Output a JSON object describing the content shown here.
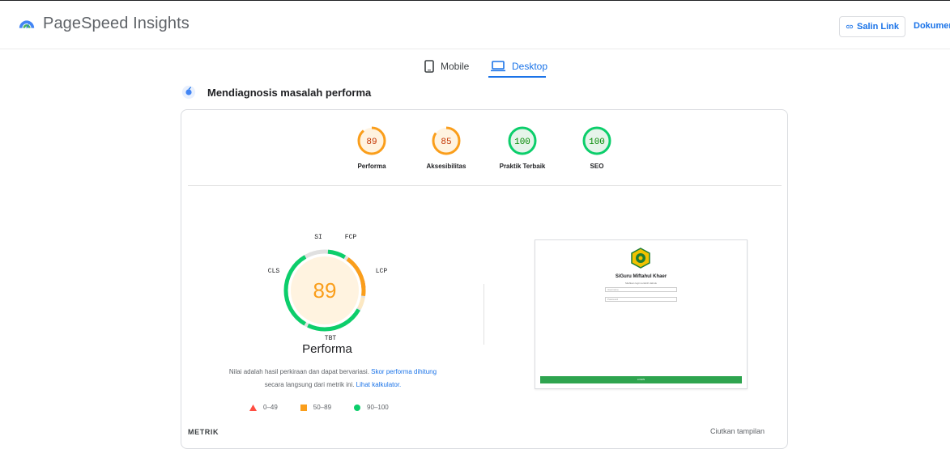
{
  "header": {
    "app_name": "PageSpeed Insights",
    "copy_link_label": "Salin Link",
    "docs_label": "Dokumentasi"
  },
  "tabs": [
    {
      "label": "Mobile",
      "icon": "smartphone-icon",
      "active": false
    },
    {
      "label": "Desktop",
      "icon": "laptop-icon",
      "active": true
    }
  ],
  "diagnosis": {
    "title": "Mendiagnosis masalah performa",
    "icon": "lighthouse-icon"
  },
  "scores": [
    {
      "value": "89",
      "label": "Performa",
      "color": "#fa9e1b",
      "fill": "#fff3e0",
      "text_color": "#c33300",
      "fraction": 0.89
    },
    {
      "value": "85",
      "label": "Aksesibilitas",
      "color": "#fa9e1b",
      "fill": "#fff3e0",
      "text_color": "#c33300",
      "fraction": 0.85
    },
    {
      "value": "100",
      "label": "Praktik Terbaik",
      "color": "#0cce6b",
      "fill": "#e6f4ea",
      "text_color": "#008800",
      "fraction": 1.0
    },
    {
      "value": "100",
      "label": "SEO",
      "color": "#0cce6b",
      "fill": "#e6f4ea",
      "text_color": "#008800",
      "fraction": 1.0
    }
  ],
  "performance": {
    "score": "89",
    "title": "Performa",
    "color": "#fa9e1b",
    "segments": [
      {
        "metric": "SI",
        "color": "#ff4e42"
      },
      {
        "metric": "FCP",
        "color": "#0cce6b"
      },
      {
        "metric": "LCP",
        "color": "#fa9e1b"
      },
      {
        "metric": "TBT",
        "color": "#0cce6b"
      },
      {
        "metric": "CLS",
        "color": "#0cce6b"
      }
    ],
    "note_text": "Nilai adalah hasil perkiraan dan dapat bervariasi. ",
    "note_link1": "Skor performa dihitung",
    "note_text2": "secara langsung dari metrik ini. ",
    "note_link2": "Lihat kalkulator."
  },
  "legend": [
    {
      "range": "0–49",
      "shape": "triangle",
      "color": "#ff4e42"
    },
    {
      "range": "50–89",
      "shape": "square",
      "color": "#fa9e1b"
    },
    {
      "range": "90–100",
      "shape": "circle",
      "color": "#0cce6b"
    }
  ],
  "preview": {
    "site_title": "SiGuru Miftahul Khaer",
    "site_subtitle": "Silahkan login terlebih dahulu",
    "username_placeholder": "Username",
    "password_placeholder": "Password",
    "login_label": "LOGIN"
  },
  "metrics": {
    "label": "METRIK",
    "collapse_label": "Ciutkan tampilan"
  }
}
